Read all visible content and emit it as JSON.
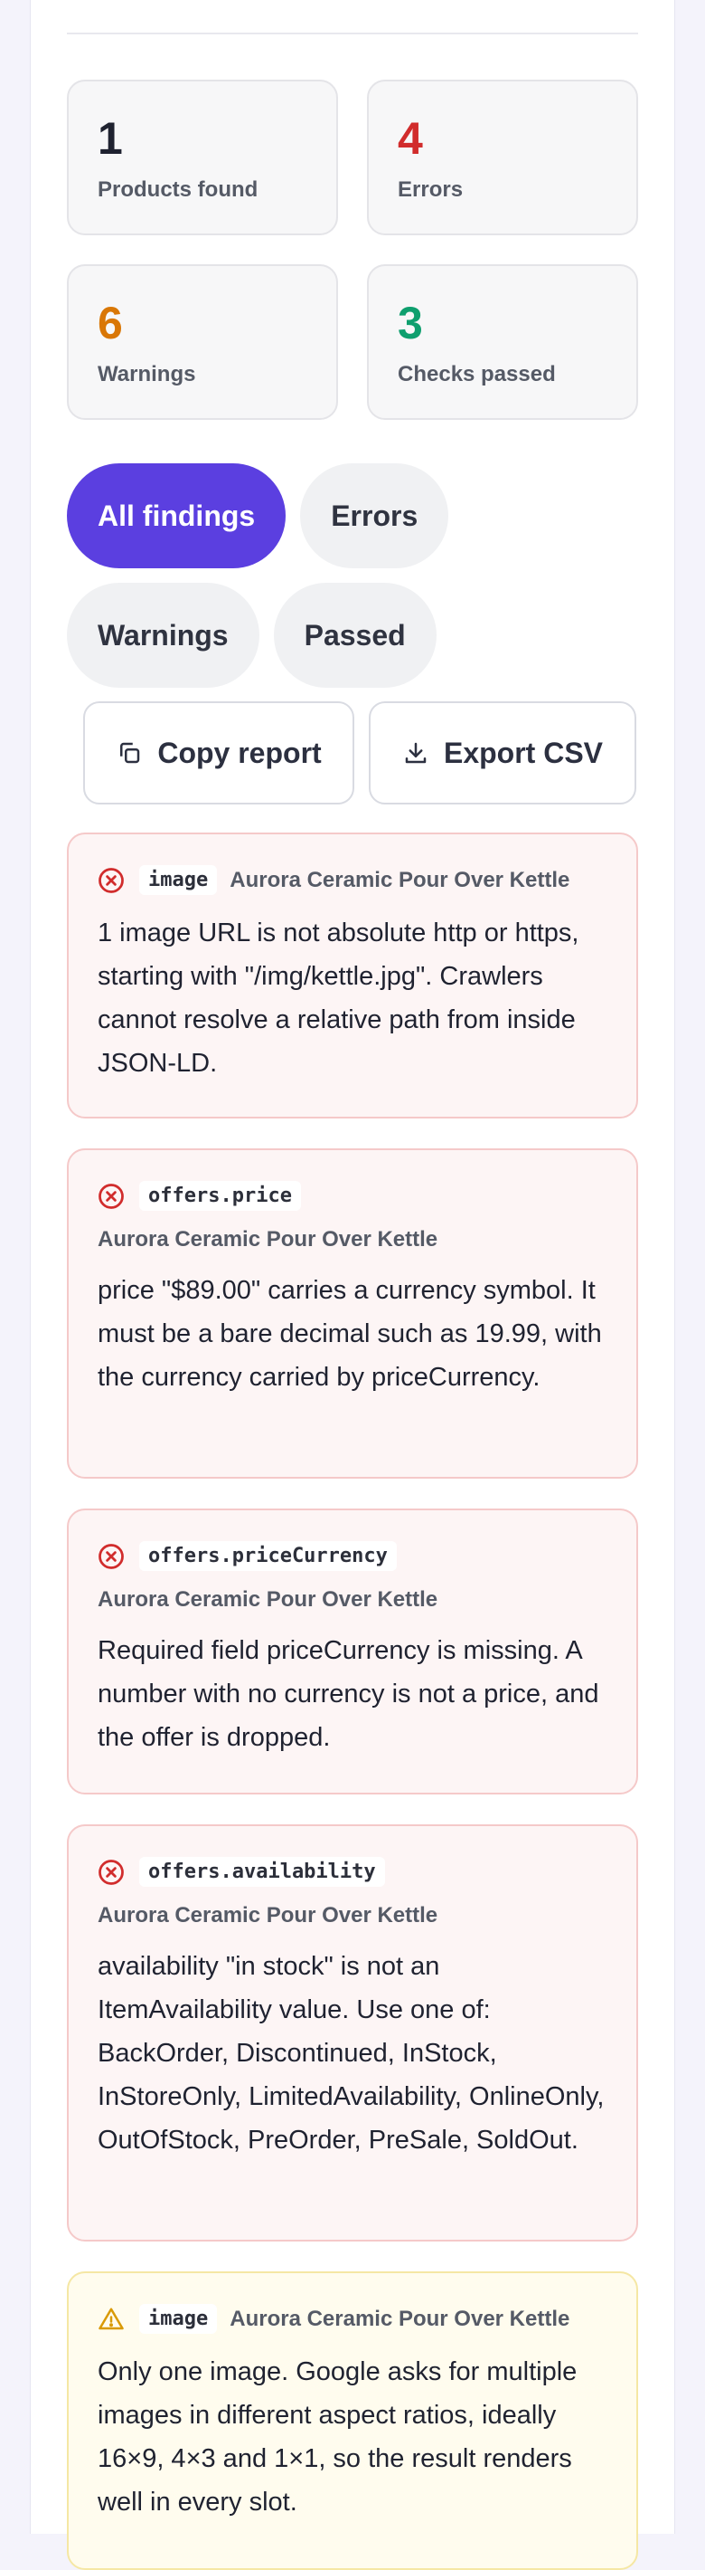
{
  "summary": [
    {
      "value": "1",
      "label": "Products found",
      "color": "#1f2230"
    },
    {
      "value": "4",
      "label": "Errors",
      "color": "#d12c2c"
    },
    {
      "value": "6",
      "label": "Warnings",
      "color": "#d97706"
    },
    {
      "value": "3",
      "label": "Checks passed",
      "color": "#0e9f6e"
    }
  ],
  "filters": [
    {
      "label": "All findings",
      "active": true
    },
    {
      "label": "Errors",
      "active": false
    },
    {
      "label": "Warnings",
      "active": false
    },
    {
      "label": "Passed",
      "active": false
    }
  ],
  "actions": {
    "copy_label": "Copy report",
    "export_label": "Export CSV"
  },
  "findings": [
    {
      "severity": "error",
      "field": "image",
      "product": "Aurora Ceramic Pour Over Kettle",
      "message": "1 image URL is not absolute http or https, starting with \"/img/kettle.jpg\". Crawlers cannot resolve a relative path from inside JSON-LD."
    },
    {
      "severity": "error",
      "field": "offers.price",
      "product": "Aurora Ceramic Pour Over Kettle",
      "message": "price \"$89.00\" carries a currency symbol. It must be a bare decimal such as 19.99, with the currency carried by priceCurrency."
    },
    {
      "severity": "error",
      "field": "offers.priceCurrency",
      "product": "Aurora Ceramic Pour Over Kettle",
      "message": "Required field priceCurrency is missing. A number with no currency is not a price, and the offer is dropped."
    },
    {
      "severity": "error",
      "field": "offers.availability",
      "product": "Aurora Ceramic Pour Over Kettle",
      "message": "availability \"in stock\" is not an ItemAvailability value. Use one of: BackOrder, Discontinued, InStock, InStoreOnly, LimitedAvailability, OnlineOnly, OutOfStock, PreOrder, PreSale, SoldOut."
    },
    {
      "severity": "warning",
      "field": "image",
      "product": "Aurora Ceramic Pour Over Kettle",
      "message": "Only one image. Google asks for multiple images in different aspect ratios, ideally 16×9, 4×3 and 1×1, so the result renders well in every slot."
    }
  ]
}
